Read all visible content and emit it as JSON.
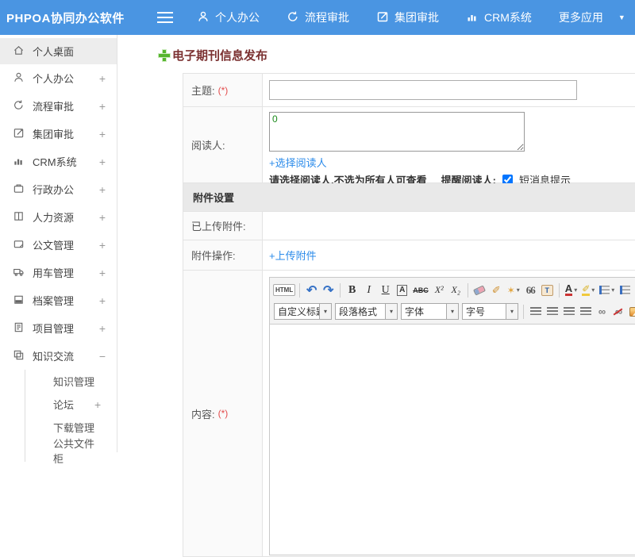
{
  "header": {
    "brand": "PHPOA协同办公软件",
    "nav": [
      {
        "label": "个人办公"
      },
      {
        "label": "流程审批"
      },
      {
        "label": "集团审批"
      },
      {
        "label": "CRM系统"
      },
      {
        "label": "更多应用"
      }
    ]
  },
  "sidebar": {
    "items": [
      {
        "label": "个人桌面",
        "toggle": ""
      },
      {
        "label": "个人办公",
        "toggle": "+"
      },
      {
        "label": "流程审批",
        "toggle": "+"
      },
      {
        "label": "集团审批",
        "toggle": "+"
      },
      {
        "label": "CRM系统",
        "toggle": "+"
      },
      {
        "label": "行政办公",
        "toggle": "+"
      },
      {
        "label": "人力资源",
        "toggle": "+"
      },
      {
        "label": "公文管理",
        "toggle": "+"
      },
      {
        "label": "用车管理",
        "toggle": "+"
      },
      {
        "label": "档案管理",
        "toggle": "+"
      },
      {
        "label": "项目管理",
        "toggle": "+"
      },
      {
        "label": "知识交流",
        "toggle": "−"
      }
    ],
    "subitems": [
      {
        "label": "知识管理",
        "toggle": ""
      },
      {
        "label": "论坛",
        "toggle": "+"
      },
      {
        "label": "下载管理",
        "toggle": ""
      },
      {
        "label": "公共文件柜",
        "toggle": ""
      }
    ]
  },
  "main": {
    "page_title": "电子期刊信息发布",
    "form": {
      "subject_label": "主题:",
      "required_mark": "(*)",
      "readers_label": "阅读人:",
      "readers_value": "0",
      "select_readers_link": "+选择阅读人",
      "readers_hint": "请选择阅读人,不选为所有人可查看",
      "remind_label": "提醒阅读人:",
      "sms_checkbox_label": "短消息提示",
      "attachments_section_title": "附件设置",
      "uploaded_attachments_label": "已上传附件:",
      "attachment_actions_label": "附件操作:",
      "upload_attachment_link": "+上传附件",
      "content_label": "内容:"
    },
    "editor": {
      "html_button": "HTML",
      "bold": "B",
      "italic": "I",
      "underline": "U",
      "boxed_a": "A",
      "strike": "ABC",
      "superscript": "X²",
      "subscript": "X₂",
      "quote": "66",
      "paste_t": "T",
      "forecolor_a": "A",
      "dropdowns": [
        {
          "label": "自定义标题"
        },
        {
          "label": "段落格式"
        },
        {
          "label": "字体"
        },
        {
          "label": "字号"
        }
      ]
    }
  },
  "icons": {
    "caret_down_small": "▾",
    "nav_caret": "▼",
    "undo": "↶",
    "redo": "↷",
    "brush": "✐",
    "wand": "✶",
    "hilite": "✐",
    "link": "∞",
    "unlink": "∞"
  },
  "colors": {
    "header_bg": "#4a95e2",
    "link": "#2b8bea",
    "page_title": "#7b3131",
    "required": "#e34b4b",
    "reader_count_green": "#1a8a1a",
    "section_bg": "#e9e9e9"
  }
}
